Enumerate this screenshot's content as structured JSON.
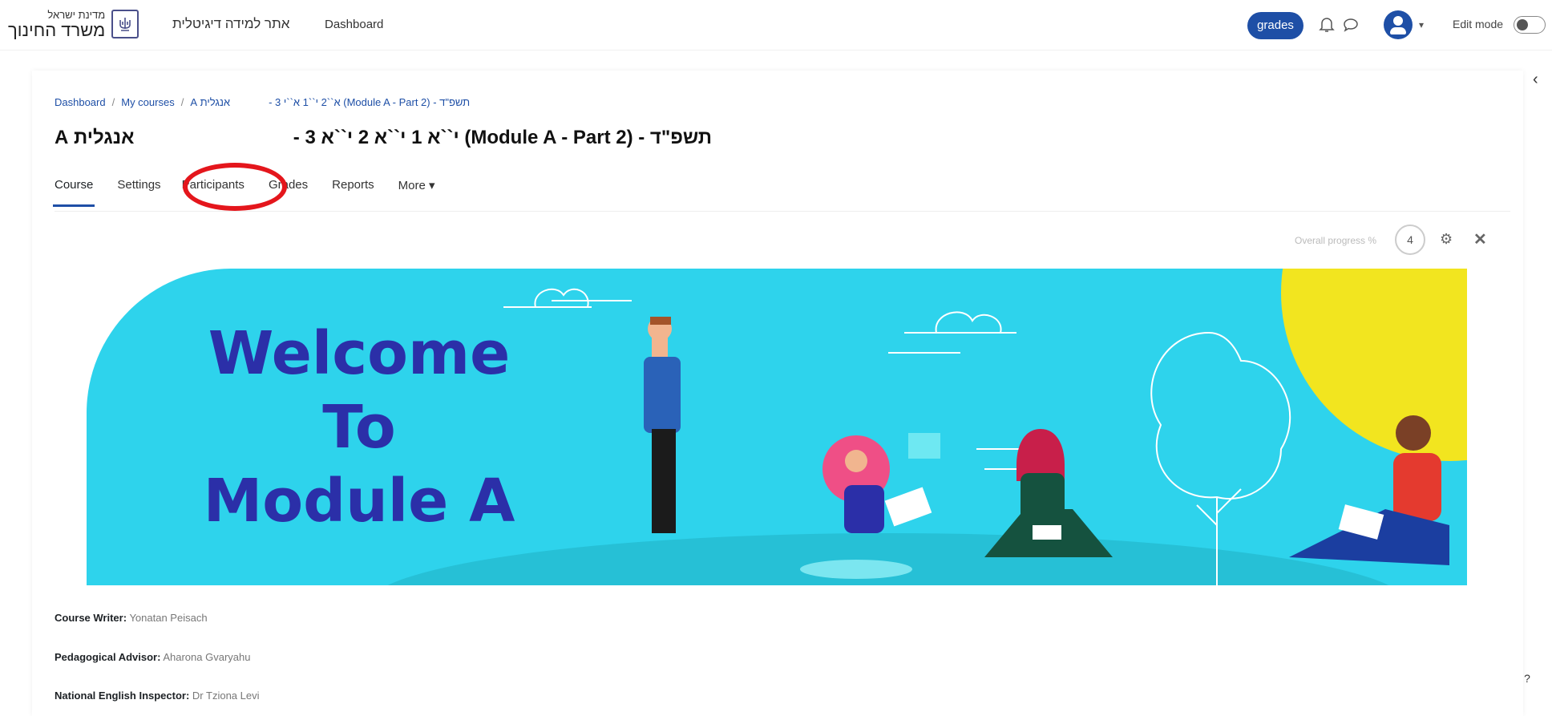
{
  "header": {
    "logo_small": "מדינת ישראל",
    "logo_big": "משרד החינוך",
    "nav_hebrew": "אתר למידה דיגיטלית",
    "nav_dashboard": "Dashboard",
    "grades_label": "grades",
    "edit_mode_label": "Edit mode"
  },
  "breadcrumb": {
    "items": [
      "Dashboard",
      "My courses",
      "אנגלית A",
      "- 3 א``2 י``1 א``י (Module A - Part 2) - תשפ\"ד"
    ],
    "separator": "/"
  },
  "page": {
    "title_left": "אנגלית A",
    "title_right": "תשפ\"ד - (Module A - Part 2) י``א 1 י``א 2 י``א 3 -"
  },
  "tabs": [
    "Course",
    "Settings",
    "Participants",
    "Grades",
    "Reports",
    "More"
  ],
  "progress": {
    "label": "Overall progress %",
    "value": "4"
  },
  "banner": {
    "line1": "Welcome",
    "line2": "To",
    "line3": "Module A"
  },
  "info": {
    "writer_label": "Course Writer:",
    "writer_value": "Yonatan Peisach",
    "advisor_label": "Pedagogical Advisor:",
    "advisor_value": "Aharona Gvaryahu",
    "inspector_label": "National English Inspector:",
    "inspector_value": "Dr Tziona Levi"
  },
  "colors": {
    "brand": "#1e4fa6",
    "banner_bg": "#2ed3ec",
    "welcome_text": "#2b2fa8",
    "highlight": "#e4161c"
  }
}
